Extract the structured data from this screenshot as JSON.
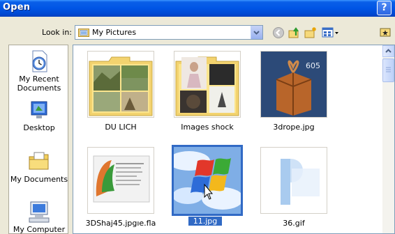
{
  "window": {
    "title": "Open",
    "help_label": "?"
  },
  "toolbar": {
    "look_in_label": "Look in:",
    "look_in_value": "My Pictures",
    "buttons": [
      "back-icon",
      "up-folder-icon",
      "new-folder-icon",
      "views-menu-icon",
      "folder-options-icon"
    ]
  },
  "places": [
    {
      "label": "My Recent Documents",
      "icon": "recent-documents-icon"
    },
    {
      "label": "Desktop",
      "icon": "desktop-icon"
    },
    {
      "label": "My Documents",
      "icon": "my-documents-icon"
    },
    {
      "label": "My Computer",
      "icon": "my-computer-icon"
    }
  ],
  "files": [
    {
      "name": "DU LICH",
      "kind": "folder"
    },
    {
      "name": "Images shock",
      "kind": "folder"
    },
    {
      "name": "3drope.jpg",
      "kind": "image"
    },
    {
      "name": "3DShaj45.jpgıe.fla",
      "kind": "flash"
    },
    {
      "name": "11.jpg",
      "kind": "image",
      "selected": true
    },
    {
      "name": "36.gif",
      "kind": "image"
    }
  ],
  "thumb_texts": {
    "cube": "605"
  },
  "colors": {
    "title_bar": "#0055E5",
    "selection": "#316AC5",
    "dialog_bg": "#ECE9D8",
    "folder": "#FBE58E"
  }
}
